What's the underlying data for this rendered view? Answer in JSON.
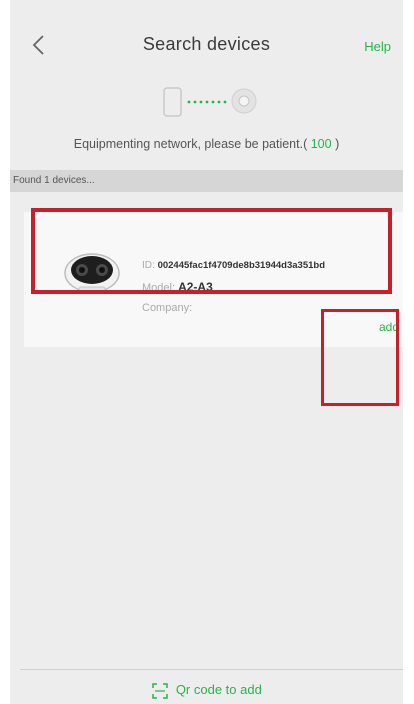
{
  "header": {
    "title": "Search devices",
    "help_label": "Help"
  },
  "network": {
    "status_text": "Equipmenting network, please be patient.",
    "progress_open": "( ",
    "progress": "100",
    "progress_close": " )"
  },
  "found_text": "Found 1 devices...",
  "device": {
    "id_label": "ID:",
    "id_value": "002445fac1f4709de8b31944d3a351bd",
    "model_label": "Model:",
    "model_value": "A2-A3",
    "company_label": "Company:",
    "status_text": "",
    "add_label": "add"
  },
  "footer": {
    "qr_label": "Qr code to add"
  },
  "colors": {
    "accent": "#27b34a",
    "highlight": "#c8202a",
    "background": "#ededed"
  },
  "icons": [
    "back-arrow-icon",
    "phone-icon",
    "camera-icon",
    "robot-camera-icon",
    "qr-scan-icon"
  ]
}
